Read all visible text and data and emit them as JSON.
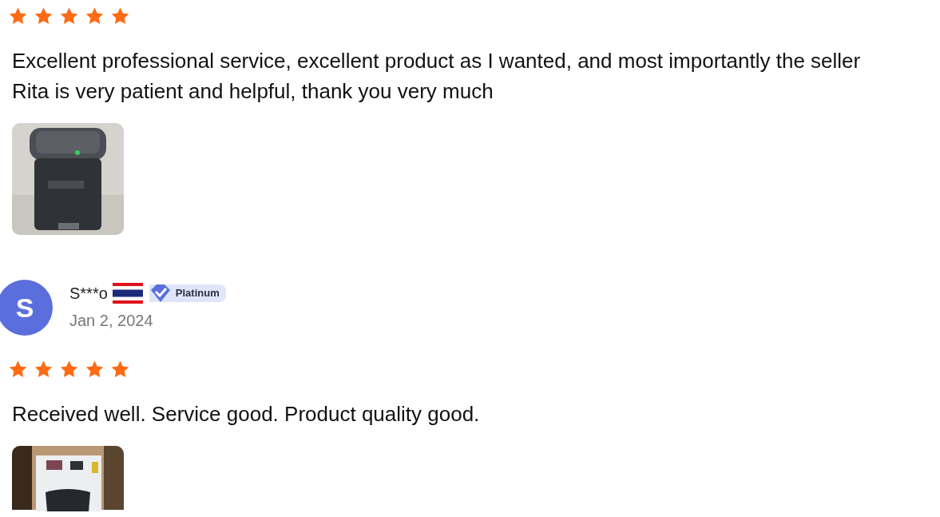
{
  "reviews": [
    {
      "stars": 5,
      "text": "Excellent professional service, excellent product as I wanted, and most importantly the seller Rita is very patient and helpful, thank you very much"
    },
    {
      "reviewer": {
        "avatar_letter": "S",
        "name": "S***o",
        "badge": "Platinum",
        "date": "Jan 2, 2024"
      },
      "stars": 5,
      "text": "Received well. Service good. Product quality good."
    }
  ]
}
